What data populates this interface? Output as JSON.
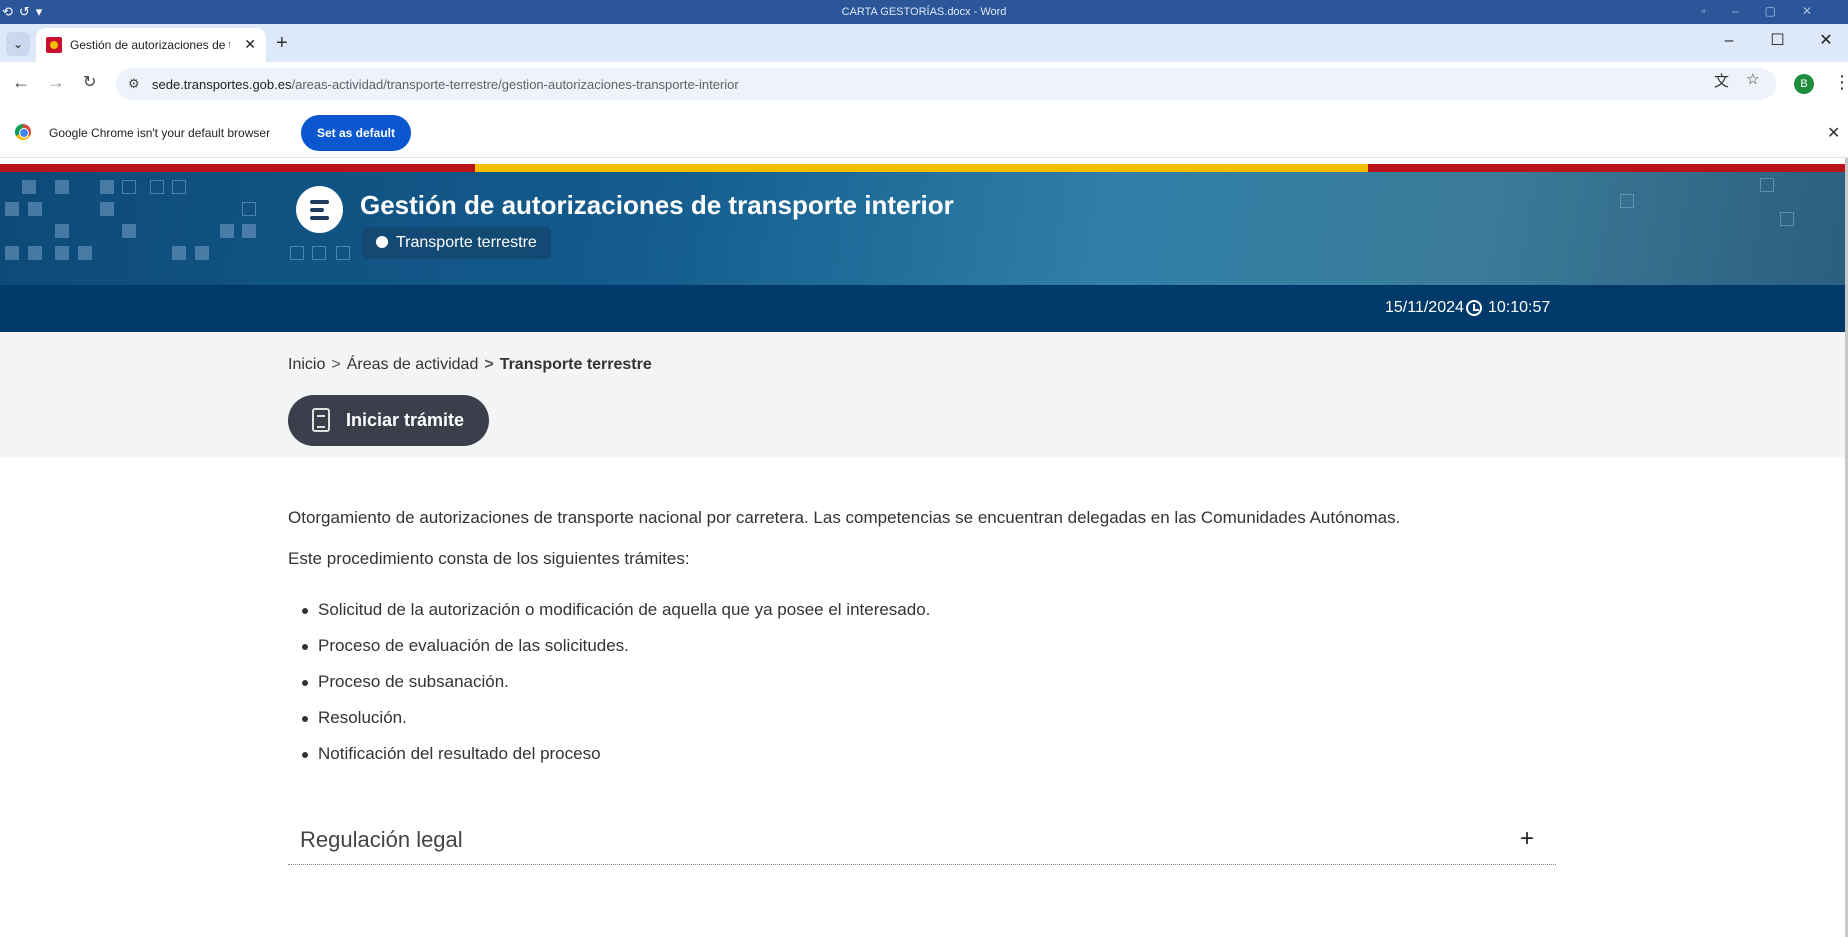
{
  "word": {
    "title": "CARTA GESTORÍAS.docx - Word"
  },
  "browser": {
    "tab_title": "Gestión de autorizaciones de tr",
    "url_host": "sede.transportes.gob.es",
    "url_path": "/areas-actividad/transporte-terrestre/gestion-autorizaciones-transporte-interior",
    "profile_initial": "B"
  },
  "infobar": {
    "message": "Google Chrome isn't your default browser",
    "button": "Set as default"
  },
  "hero": {
    "title": "Gestión de autorizaciones de transporte interior",
    "tag": "Transporte terrestre",
    "date": "15/11/2024",
    "time": "10:10:57"
  },
  "breadcrumb": {
    "home": "Inicio",
    "areas": "Áreas de actividad",
    "current": "Transporte terrestre"
  },
  "action": {
    "iniciar": "Iniciar trámite"
  },
  "content": {
    "intro": "Otorgamiento de autorizaciones de transporte nacional por carretera. Las competencias se encuentran delegadas en las Comunidades Autónomas.",
    "lead": "Este procedimiento consta de los siguientes trámites:",
    "steps": [
      "Solicitud de la autorización o modificación de aquella que ya posee el interesado.",
      "Proceso de evaluación de las solicitudes.",
      "Proceso de subsanación.",
      "Resolución.",
      "Notificación del resultado del proceso"
    ]
  },
  "accordion": {
    "title": "Regulación legal"
  },
  "colors": {
    "header_dark": "#003a6a",
    "button_dark": "#3a3f4b",
    "chrome_blue": "#0b57d0"
  }
}
